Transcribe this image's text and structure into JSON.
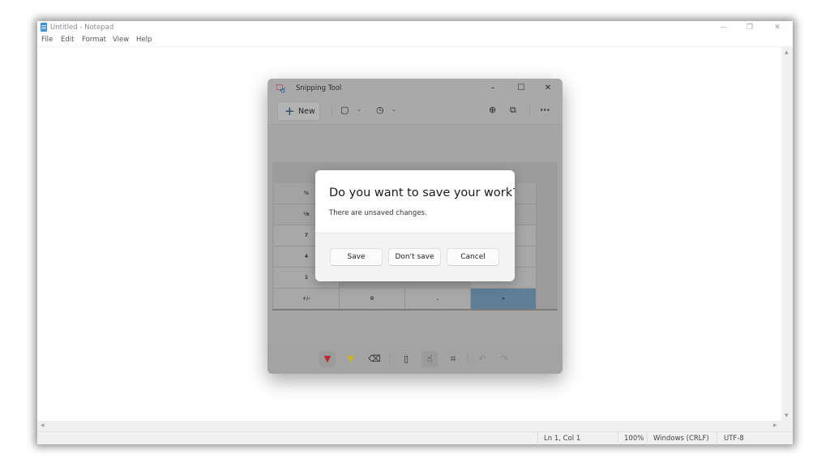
{
  "notepad": {
    "title": "Untitled - Notepad",
    "controls": {
      "minimize": "—",
      "maximize": "❐",
      "close": "✕"
    },
    "menu": [
      "File",
      "Edit",
      "Format",
      "View",
      "Help"
    ],
    "editor_text": "",
    "scroll_arrows": {
      "up": "▲",
      "down": "▼",
      "left": "◀",
      "right": "▶"
    },
    "status": {
      "position": "Ln 1, Col 1",
      "zoom": "100%",
      "line_ending": "Windows (CRLF)",
      "encoding": "UTF-8"
    }
  },
  "snipping_tool": {
    "title": "Snipping Tool",
    "controls": {
      "minimize": "–",
      "maximize": "☐",
      "close": "✕"
    },
    "toolbar": {
      "new_label": "New",
      "new_icon": "+",
      "mode_icon": "▢",
      "delay_icon": "◷",
      "chevron": "⌄",
      "zoom_icon": "⊕",
      "copy_icon": "⧉",
      "more_icon": "···"
    },
    "calculator_keys": [
      [
        "",
        "",
        "",
        ""
      ],
      [
        "%",
        "",
        "",
        ""
      ],
      [
        "⅟x",
        "",
        "",
        ""
      ],
      [
        "7",
        "",
        "",
        ""
      ],
      [
        "4",
        "",
        "",
        ""
      ],
      [
        "1",
        "",
        "",
        ""
      ],
      [
        "+/-",
        "0",
        ".",
        "="
      ]
    ],
    "bottom_tools": {
      "pen": "▼",
      "highlighter": "▼",
      "eraser": "⌫",
      "ruler": "▯",
      "touch_writing": "☝",
      "crop": "⌗",
      "undo": "↶",
      "redo": "↷"
    }
  },
  "dialog": {
    "title": "Do you want to save your work?",
    "message": "There are unsaved changes.",
    "buttons": {
      "save": "Save",
      "dont_save": "Don't save",
      "cancel": "Cancel"
    }
  }
}
